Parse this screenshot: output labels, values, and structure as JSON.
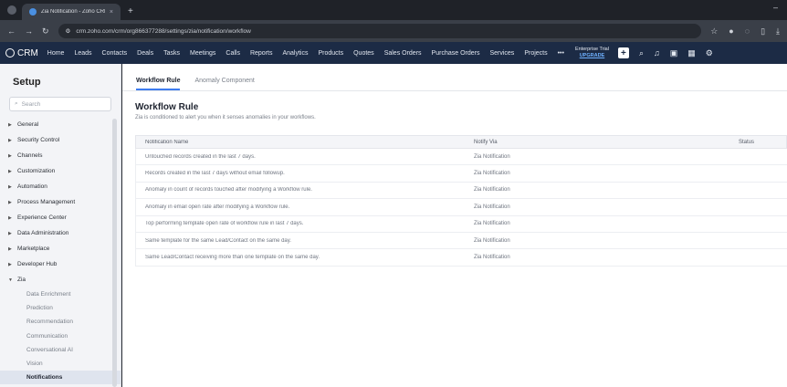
{
  "browser": {
    "tab_title": "Zia Notification - Zoho CRM",
    "tab_close": "×",
    "new_tab": "+",
    "minimize": "–",
    "url": "crm.zoho.com/crm/org866377288/settings/zia/notification/workflow",
    "icons": [
      "back-icon",
      "forward-icon",
      "reload-icon",
      "site-info-icon",
      "bookmark-star-icon",
      "extension-icon",
      "menu-icon"
    ]
  },
  "crm_nav": {
    "logo_text": "CRM",
    "items": [
      "Home",
      "Leads",
      "Contacts",
      "Deals",
      "Tasks",
      "Meetings",
      "Calls",
      "Reports",
      "Analytics",
      "Products",
      "Quotes",
      "Sales Orders",
      "Purchase Orders",
      "Services",
      "Projects"
    ],
    "more": "•••",
    "trial_label": "Enterprise Trial",
    "upgrade_label": "UPGRADE",
    "plus": "+"
  },
  "sidebar": {
    "title": "Setup",
    "search_placeholder": "Search",
    "items": [
      "General",
      "Security Control",
      "Channels",
      "Customization",
      "Automation",
      "Process Management",
      "Experience Center",
      "Data Administration",
      "Marketplace",
      "Developer Hub"
    ],
    "expanded_item": "Zia",
    "sub_items": [
      "Data Enrichment",
      "Prediction",
      "Recommendation",
      "Communication",
      "Conversational AI",
      "Vision",
      "Notifications"
    ],
    "active_sub_item": "Notifications"
  },
  "main": {
    "tabs": [
      "Workflow Rule",
      "Anomaly Component"
    ],
    "active_tab": "Workflow Rule",
    "title": "Workflow Rule",
    "description": "Zia is conditioned to alert you when it senses anomalies in your workflows.",
    "columns": [
      "Notification Name",
      "Notify Via",
      "Status"
    ],
    "rows": [
      {
        "name": "Untouched records created in the last 7 days.",
        "via": "Zia Notification",
        "status": "on"
      },
      {
        "name": "Records created in the last 7 days without email followup.",
        "via": "Zia Notification",
        "status": "on"
      },
      {
        "name": "Anomaly in count of records touched after modifying a Workflow rule.",
        "via": "Zia Notification",
        "status": "on"
      },
      {
        "name": "Anomaly in email open rate after modifying a Workflow rule.",
        "via": "Zia Notification",
        "status": "on"
      },
      {
        "name": "Top performing template open rate of workflow rule in last 7 days.",
        "via": "Zia Notification",
        "status": "on"
      },
      {
        "name": "Same template for the same Lead/Contact on the same day.",
        "via": "Zia Notification",
        "status": "on"
      },
      {
        "name": "Same Lead/Contact receiving more than one template on the same day.",
        "via": "Zia Notification",
        "status": "on"
      }
    ],
    "toggle_color": "#2ea043"
  }
}
